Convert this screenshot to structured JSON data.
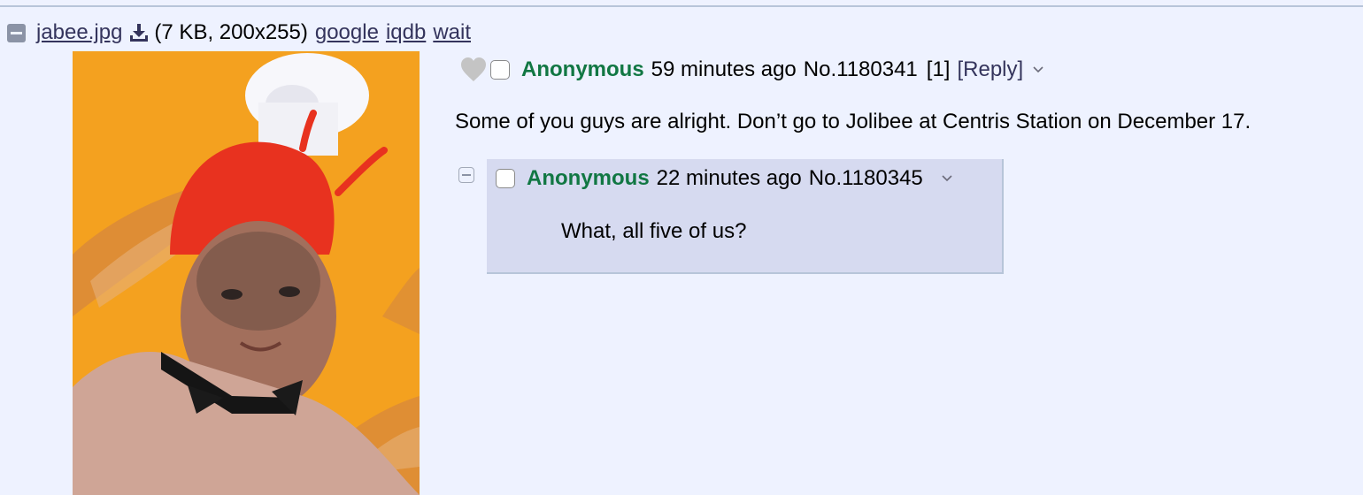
{
  "file": {
    "name": "jabee.jpg",
    "meta": "(7 KB, 200x255)",
    "search_links": [
      "google",
      "iqdb",
      "wait"
    ],
    "hide_icon": "minus-square-icon",
    "download_icon": "download-icon"
  },
  "op": {
    "name": "Anonymous",
    "time": "59 minutes ago",
    "post_number": "No.1180341",
    "backlink": "[1]",
    "reply_open": "[",
    "reply_label": "Reply",
    "reply_close": "]",
    "message": "Some of you guys are alright. Don’t go to Jolibee at Centris Station on December 17.",
    "icons": [
      "heart-icon",
      "chevron-down-icon"
    ]
  },
  "reply": {
    "name": "Anonymous",
    "time": "22 minutes ago",
    "post_number": "No.1180345",
    "message": "What, all five of us?",
    "icons": [
      "collapse-icon",
      "chevron-down-icon"
    ]
  },
  "colors": {
    "background": "#eef2ff",
    "reply_background": "#d6daf0",
    "name": "#117743",
    "link": "#34345c",
    "border": "#b7c5d9"
  }
}
